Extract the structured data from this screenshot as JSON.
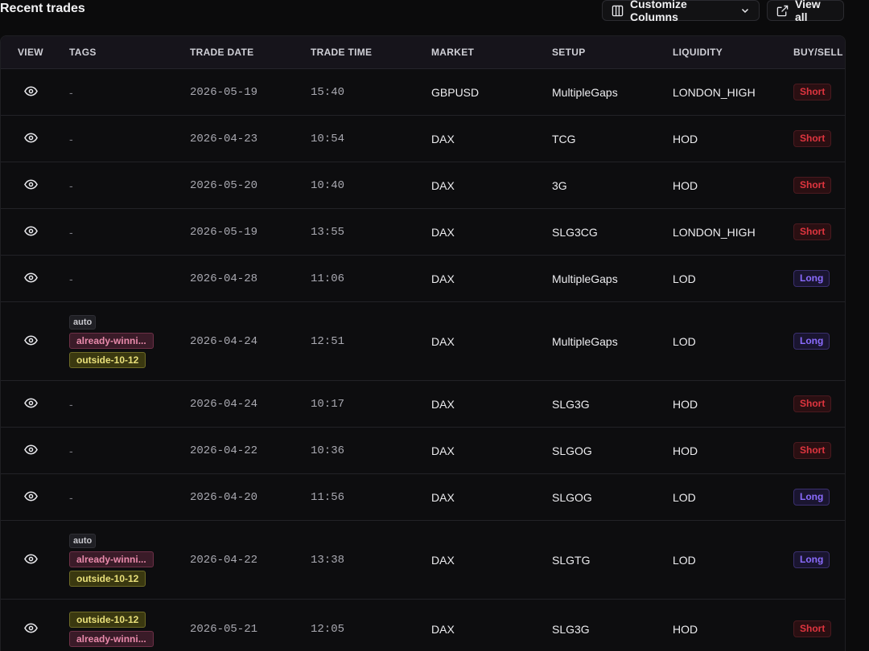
{
  "header": {
    "title": "Recent trades",
    "customize_label": "Customize Columns",
    "view_all_label": "View all"
  },
  "columns": [
    "VIEW",
    "TAGS",
    "TRADE DATE",
    "TRADE TIME",
    "MARKET",
    "SETUP",
    "LIQUIDITY",
    "BUY/SELL"
  ],
  "colors": {
    "short": "#e0353f",
    "long": "#8b6cff",
    "tag_pink": "#e98aab",
    "tag_yellow": "#e9e07a"
  },
  "rows": [
    {
      "tags": [],
      "date": "2026-05-19",
      "time": "15:40",
      "market": "GBPUSD",
      "setup": "MultipleGaps",
      "liquidity": "LONDON_HIGH",
      "side": "Short"
    },
    {
      "tags": [],
      "date": "2026-04-23",
      "time": "10:54",
      "market": "DAX",
      "setup": "TCG",
      "liquidity": "HOD",
      "side": "Short"
    },
    {
      "tags": [],
      "date": "2026-05-20",
      "time": "10:40",
      "market": "DAX",
      "setup": "3G",
      "liquidity": "HOD",
      "side": "Short"
    },
    {
      "tags": [],
      "date": "2026-05-19",
      "time": "13:55",
      "market": "DAX",
      "setup": "SLG3CG",
      "liquidity": "LONDON_HIGH",
      "side": "Short"
    },
    {
      "tags": [],
      "date": "2026-04-28",
      "time": "11:06",
      "market": "DAX",
      "setup": "MultipleGaps",
      "liquidity": "LOD",
      "side": "Long"
    },
    {
      "tags": [
        {
          "label": "auto",
          "style": "auto"
        },
        {
          "label": "already-winni...",
          "style": "pink"
        },
        {
          "label": "outside-10-12",
          "style": "yellow"
        }
      ],
      "date": "2026-04-24",
      "time": "12:51",
      "market": "DAX",
      "setup": "MultipleGaps",
      "liquidity": "LOD",
      "side": "Long"
    },
    {
      "tags": [],
      "date": "2026-04-24",
      "time": "10:17",
      "market": "DAX",
      "setup": "SLG3G",
      "liquidity": "HOD",
      "side": "Short"
    },
    {
      "tags": [],
      "date": "2026-04-22",
      "time": "10:36",
      "market": "DAX",
      "setup": "SLGOG",
      "liquidity": "HOD",
      "side": "Short"
    },
    {
      "tags": [],
      "date": "2026-04-20",
      "time": "11:56",
      "market": "DAX",
      "setup": "SLGOG",
      "liquidity": "LOD",
      "side": "Long"
    },
    {
      "tags": [
        {
          "label": "auto",
          "style": "auto"
        },
        {
          "label": "already-winni...",
          "style": "pink"
        },
        {
          "label": "outside-10-12",
          "style": "yellow"
        }
      ],
      "date": "2026-04-22",
      "time": "13:38",
      "market": "DAX",
      "setup": "SLGTG",
      "liquidity": "LOD",
      "side": "Long"
    },
    {
      "tags": [
        {
          "label": "outside-10-12",
          "style": "yellow"
        },
        {
          "label": "already-winni...",
          "style": "pink"
        }
      ],
      "date": "2026-05-21",
      "time": "12:05",
      "market": "DAX",
      "setup": "SLG3G",
      "liquidity": "HOD",
      "side": "Short"
    }
  ]
}
